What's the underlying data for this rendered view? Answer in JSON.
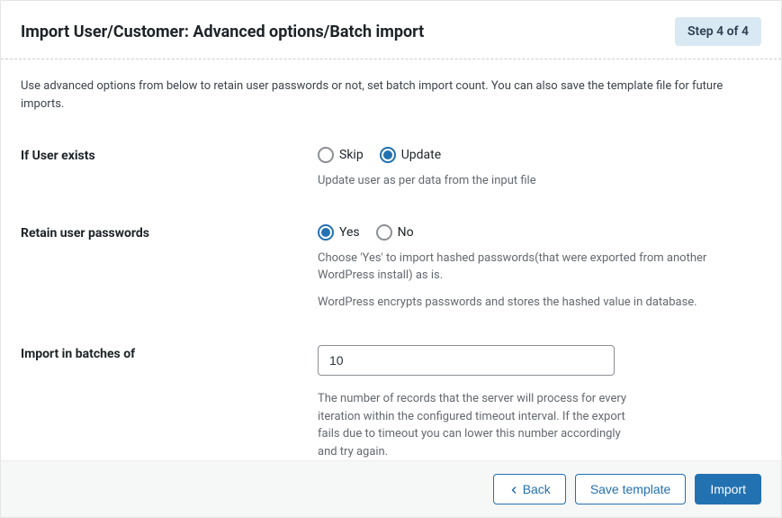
{
  "header": {
    "title": "Import User/Customer: Advanced options/Batch import",
    "step_badge": "Step 4 of 4"
  },
  "intro": "Use advanced options from below to retain user passwords or not, set batch import count. You can also save the template file for future imports.",
  "fields": {
    "user_exists": {
      "label": "If User exists",
      "option_skip": "Skip",
      "option_update": "Update",
      "selected": "update",
      "help": "Update user as per data from the input file"
    },
    "retain_passwords": {
      "label": "Retain user passwords",
      "option_yes": "Yes",
      "option_no": "No",
      "selected": "yes",
      "help1": "Choose 'Yes' to import hashed passwords(that were exported from another WordPress install) as is.",
      "help2": "WordPress encrypts passwords and stores the hashed value in database."
    },
    "batch": {
      "label": "Import in batches of",
      "value": "10",
      "help": "The number of records that the server will process for every iteration within the configured timeout interval. If the export fails due to timeout you can lower this number accordingly and try again."
    }
  },
  "footer": {
    "back": "Back",
    "save_template": "Save template",
    "import": "Import"
  }
}
